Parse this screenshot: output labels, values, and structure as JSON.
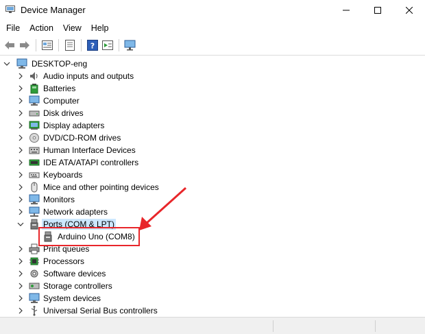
{
  "window": {
    "title": "Device Manager",
    "icon": "device-manager-icon",
    "controls": [
      "minimize",
      "maximize",
      "close"
    ]
  },
  "menu": {
    "items": [
      "File",
      "Action",
      "View",
      "Help"
    ]
  },
  "toolbar": {
    "buttons": [
      "back-icon",
      "forward-icon",
      "properties-icon",
      "view-icon",
      "help-icon",
      "details-icon",
      "scan-hardware-icon"
    ]
  },
  "tree": {
    "root": "DESKTOP-eng",
    "nodes": [
      {
        "label": "Audio inputs and outputs",
        "icon": "speaker-icon"
      },
      {
        "label": "Batteries",
        "icon": "battery-icon"
      },
      {
        "label": "Computer",
        "icon": "computer-icon"
      },
      {
        "label": "Disk drives",
        "icon": "disk-drive-icon"
      },
      {
        "label": "Display adapters",
        "icon": "display-adapter-icon"
      },
      {
        "label": "DVD/CD-ROM drives",
        "icon": "dvd-icon"
      },
      {
        "label": "Human Interface Devices",
        "icon": "hid-icon"
      },
      {
        "label": "IDE ATA/ATAPI controllers",
        "icon": "ide-controller-icon"
      },
      {
        "label": "Keyboards",
        "icon": "keyboard-icon"
      },
      {
        "label": "Mice and other pointing devices",
        "icon": "mouse-icon"
      },
      {
        "label": "Monitors",
        "icon": "monitor-icon"
      },
      {
        "label": "Network adapters",
        "icon": "network-adapter-icon"
      },
      {
        "label": "Ports (COM & LPT)",
        "icon": "port-icon",
        "expanded": true,
        "selected": true,
        "children": [
          {
            "label": "Arduino Uno (COM8)",
            "icon": "port-icon"
          }
        ]
      },
      {
        "label": "Print queues",
        "icon": "printer-icon"
      },
      {
        "label": "Processors",
        "icon": "processor-icon"
      },
      {
        "label": "Software devices",
        "icon": "software-device-icon"
      },
      {
        "label": "Storage controllers",
        "icon": "storage-controller-icon"
      },
      {
        "label": "System devices",
        "icon": "system-device-icon"
      },
      {
        "label": "Universal Serial Bus controllers",
        "icon": "usb-icon"
      }
    ]
  },
  "annotation": {
    "box_color": "#e8262a",
    "arrow_color": "#e8262a"
  },
  "colors": {
    "selection": "#cce8ff",
    "accent": "#1e73d2"
  }
}
